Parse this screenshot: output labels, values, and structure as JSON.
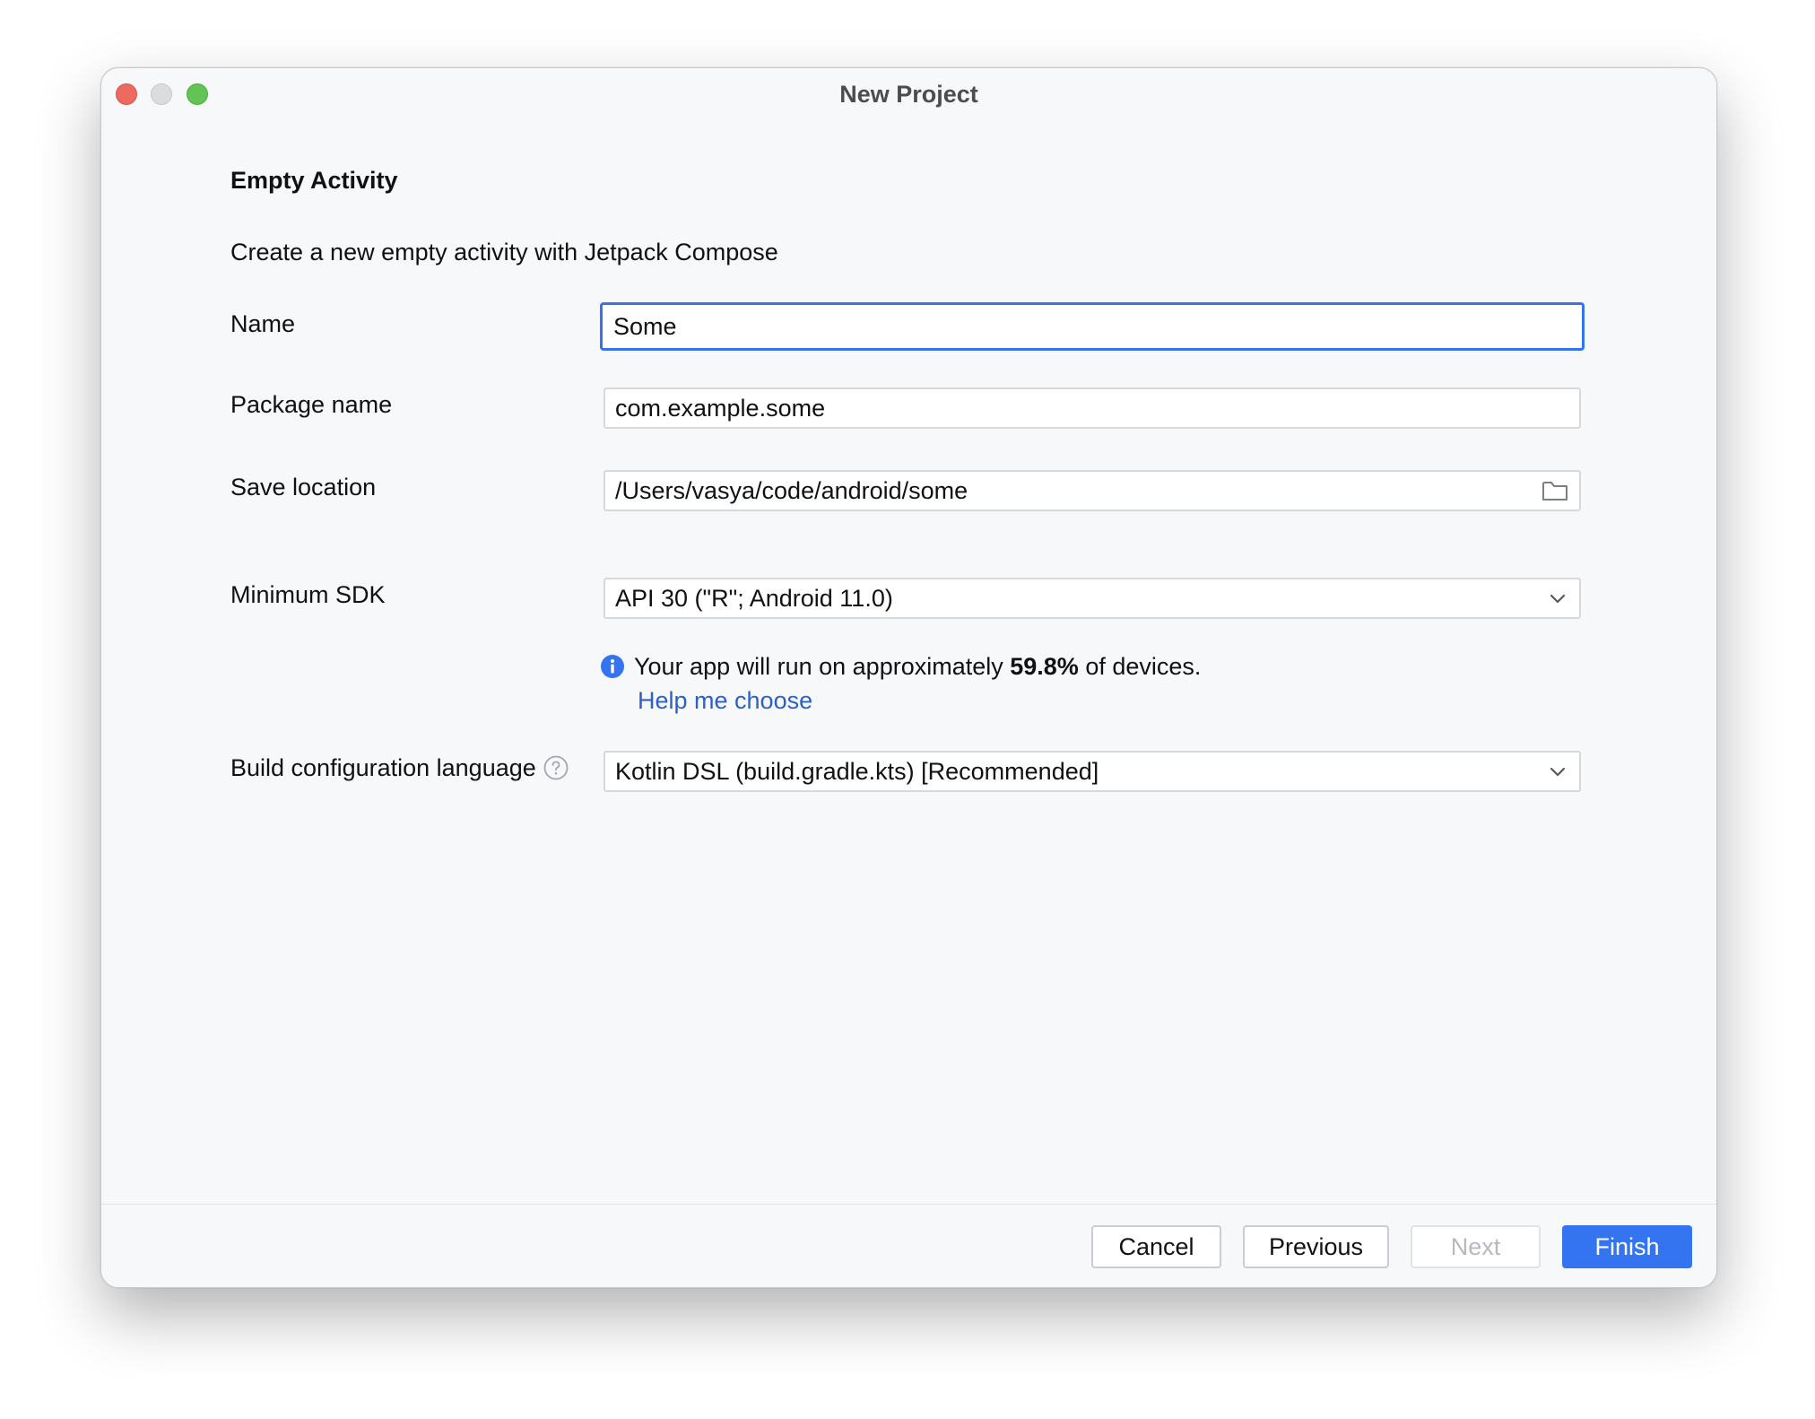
{
  "window": {
    "title": "New Project"
  },
  "header": {
    "section_title": "Empty Activity",
    "description": "Create a new empty activity with Jetpack Compose"
  },
  "form": {
    "name": {
      "label": "Name",
      "value": "Some"
    },
    "package_name": {
      "label": "Package name",
      "value": "com.example.some"
    },
    "save_location": {
      "label": "Save location",
      "value": "/Users/vasya/code/android/some",
      "icon": "folder-icon"
    },
    "minimum_sdk": {
      "label": "Minimum SDK",
      "value": "API 30 (\"R\"; Android 11.0)"
    },
    "build_config_language": {
      "label": "Build configuration language",
      "value": "Kotlin DSL (build.gradle.kts) [Recommended]",
      "help_icon": "question-icon"
    }
  },
  "info": {
    "prefix": "Your app will run on approximately ",
    "percent": "59.8%",
    "suffix": " of devices.",
    "help_link": "Help me choose",
    "icon": "info-icon"
  },
  "footer": {
    "cancel_label": "Cancel",
    "previous_label": "Previous",
    "next_label": "Next",
    "finish_label": "Finish"
  },
  "colors": {
    "accent": "#3574f0",
    "link": "#2e5fc4",
    "close": "#ed6a5e",
    "zoom": "#61c454"
  }
}
